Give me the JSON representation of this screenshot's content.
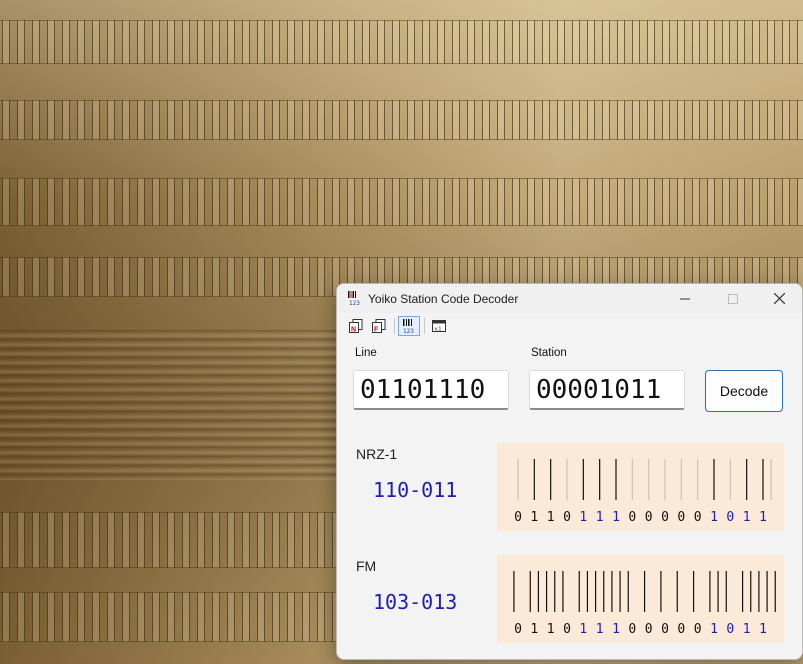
{
  "window": {
    "title": "Yoiko Station Code Decoder",
    "icons": {
      "app": "app-barcode-icon",
      "minimize": "minimize-icon",
      "maximize": "maximize-icon",
      "close": "close-icon"
    }
  },
  "toolbar": {
    "buttons": [
      {
        "name": "copy-nrz-icon",
        "active": false
      },
      {
        "name": "copy-fm-icon",
        "active": false
      },
      {
        "name": "barcode-decode-icon",
        "active": true
      },
      {
        "name": "version-info-icon",
        "active": false
      }
    ]
  },
  "form": {
    "line_label": "Line",
    "line_value": "01101110",
    "station_label": "Station",
    "station_value": "00001011",
    "decode_label": "Decode"
  },
  "results": {
    "nrz": {
      "label": "NRZ-1",
      "code": "110-011",
      "bits": "0110111000001011",
      "bar_count": 13
    },
    "fm": {
      "label": "FM",
      "code": "103-013",
      "bits": "0110111000001011",
      "bar_count": 33
    }
  },
  "colors": {
    "accent": "#2a6fb7",
    "code_text": "#1d1db8",
    "highlight_bits": "#1d1db8",
    "panel_bg": "#fbead8",
    "dark_bar": "#111111",
    "faint_bar": "#c9c4bd"
  }
}
